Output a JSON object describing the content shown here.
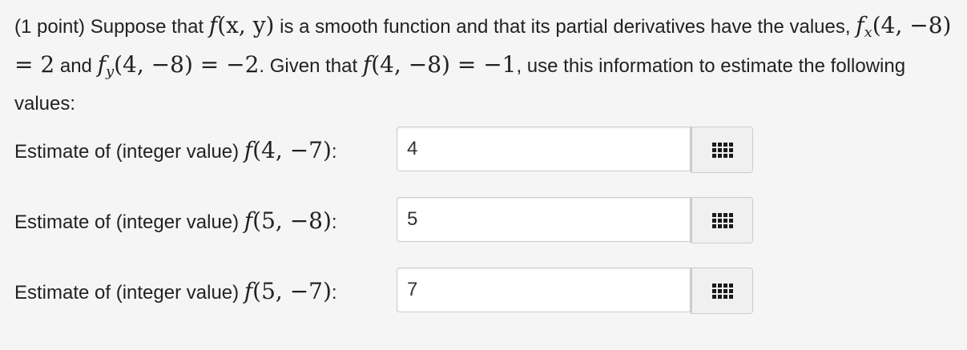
{
  "problem": {
    "prefix": "(1 point) Suppose that ",
    "func": "f",
    "func_args": "(x, y)",
    "text_1": " is a smooth function and that its partial derivatives have the values, ",
    "fx_func": "f",
    "fx_sub": "x",
    "fx_args": "(4, −8) = 2",
    "text_2": " and ",
    "fy_func": "f",
    "fy_sub": "y",
    "fy_args": "(4, −8) = −2",
    "text_3": ". Given that ",
    "fval_func": "f",
    "fval_args": "(4, −8) = −1",
    "text_4": ", use this information to estimate the following values:"
  },
  "answers": [
    {
      "label_prefix": "Estimate of (integer value) ",
      "func": "f",
      "args": "(4, −7)",
      "suffix": ":",
      "value": "4"
    },
    {
      "label_prefix": "Estimate of (integer value) ",
      "func": "f",
      "args": "(5, −8)",
      "suffix": ":",
      "value": "5"
    },
    {
      "label_prefix": "Estimate of (integer value) ",
      "func": "f",
      "args": "(5, −7)",
      "suffix": ":",
      "value": "7"
    }
  ],
  "icons": {
    "palette": "grid-icon"
  }
}
